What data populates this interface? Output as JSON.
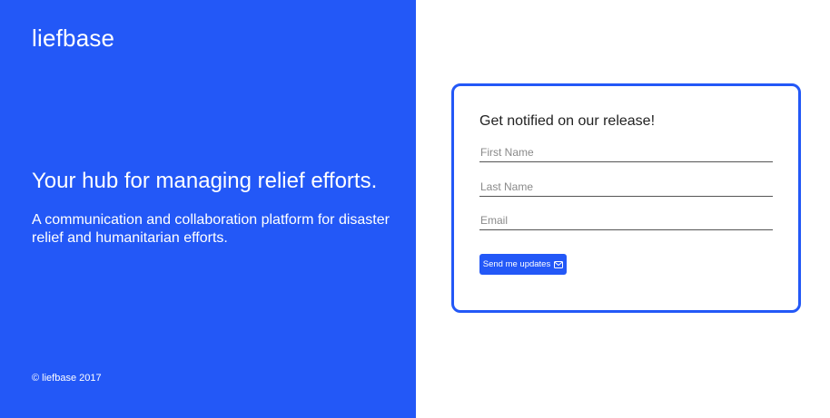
{
  "brand": {
    "logo_text": "liefbase"
  },
  "hero": {
    "headline": "Your hub for managing relief efforts.",
    "subheadline": "A communication and collaboration platform for disaster relief and humanitarian efforts."
  },
  "footer": {
    "copyright": "© liefbase 2017"
  },
  "signup": {
    "title": "Get notified on our release!",
    "first_name_placeholder": "First Name",
    "last_name_placeholder": "Last Name",
    "email_placeholder": "Email",
    "submit_label": "Send me updates",
    "submit_icon": "envelope-icon"
  },
  "colors": {
    "brand_blue": "#2358f7"
  }
}
